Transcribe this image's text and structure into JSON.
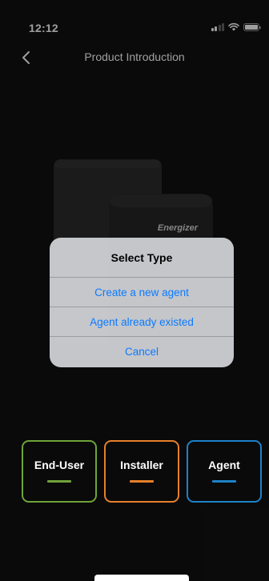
{
  "status_bar": {
    "time": "12:12"
  },
  "nav": {
    "title": "Product Introduction"
  },
  "product": {
    "brand": "Energizer"
  },
  "dialog": {
    "title": "Select Type",
    "actions": [
      "Create a new agent",
      "Agent already existed",
      "Cancel"
    ]
  },
  "types": [
    {
      "label": "End-User",
      "color": "#6fa33a"
    },
    {
      "label": "Installer",
      "color": "#e6802a"
    },
    {
      "label": "Agent",
      "color": "#1d82c8"
    }
  ],
  "colors": {
    "background": "#111111",
    "link": "#0a7aff"
  }
}
